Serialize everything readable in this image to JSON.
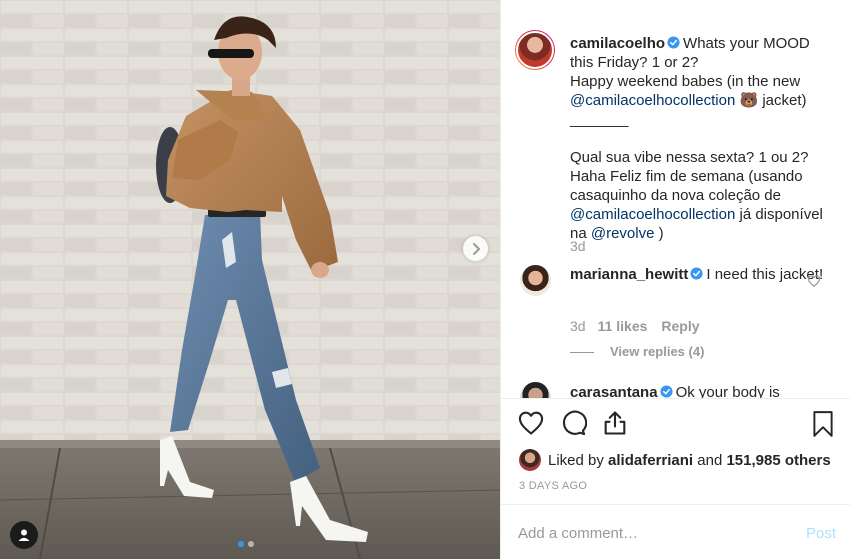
{
  "post": {
    "username": "camilacoelho",
    "caption_line1": "Whats your MOOD",
    "caption_line2": "this Friday? 1 or 2?",
    "caption_line3": "Happy weekend babes (in the new",
    "caption_mention1": "@camilacoelhocollection",
    "caption_emoji": "🐻",
    "caption_line3_end": "jacket)",
    "caption_separator": "_______",
    "caption_pt1": "Qual sua vibe nessa sexta? 1 ou 2?",
    "caption_pt2": "Haha Feliz fim de semana (usando",
    "caption_pt3": "casaquinho da nova coleção de",
    "caption_mention2": "@camilacoelhocollection",
    "caption_pt4": "já disponível",
    "caption_pt5_prefix": "na",
    "caption_mention3": "@revolve",
    "caption_pt5_suffix": ")",
    "age": "3d"
  },
  "comments": [
    {
      "username": "marianna_hewitt",
      "text": "I need this jacket!",
      "age": "3d",
      "likes": "11 likes",
      "reply_label": "Reply",
      "view_replies": "View replies (4)"
    },
    {
      "username": "carasantana",
      "text": "Ok your body is"
    }
  ],
  "liked_by": {
    "prefix": "Liked by",
    "user": "alidaferriani",
    "and": "and",
    "others": "151,985 others"
  },
  "timestamp": "3 DAYS AGO",
  "add_comment_placeholder": "Add a comment…",
  "post_button": "Post",
  "colors": {
    "verified": "#3897f0",
    "mention": "#003569",
    "muted": "#999999",
    "post_disabled": "#b2dffc"
  },
  "icons": [
    "heart-icon",
    "comment-icon",
    "share-icon",
    "bookmark-icon",
    "chevron-right-icon",
    "user-tag-icon",
    "verified-badge-icon"
  ]
}
